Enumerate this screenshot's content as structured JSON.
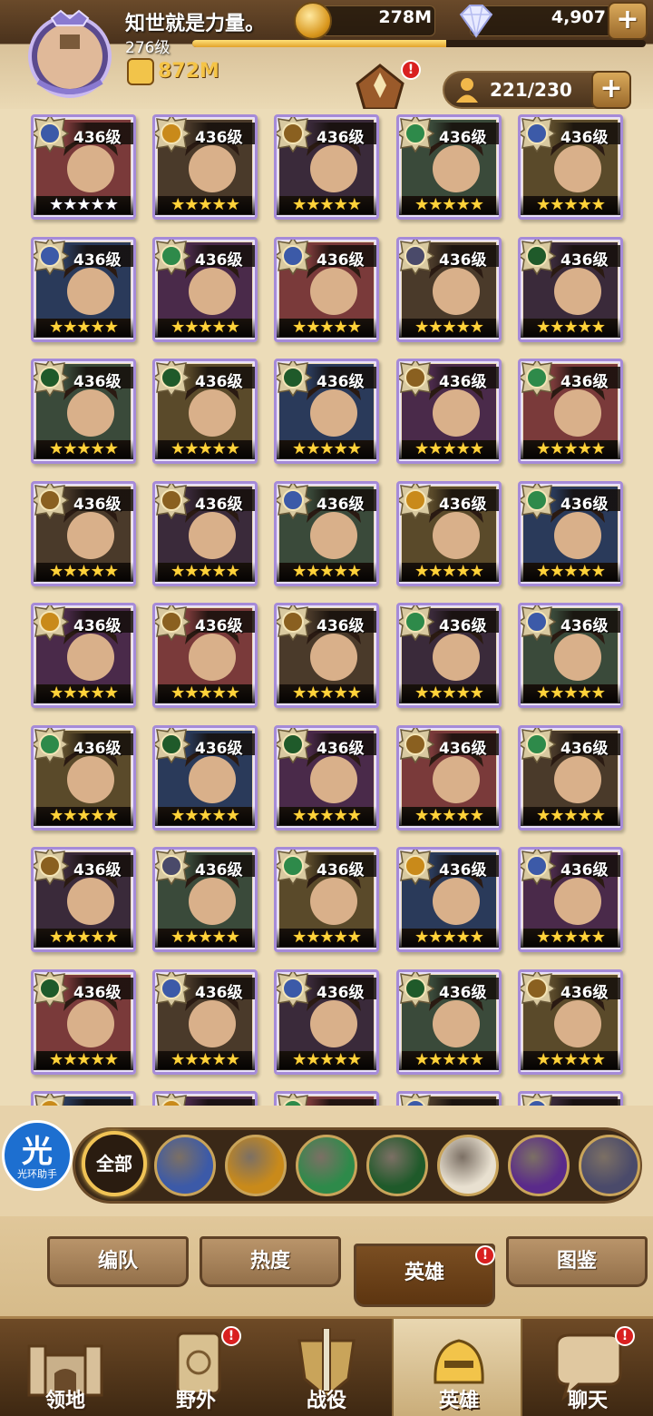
{
  "player": {
    "name": "知世就是力量。",
    "level": "276级",
    "power": "872M",
    "xp_fraction": 0.56
  },
  "resources": {
    "gold": "278M",
    "gems": "4,907"
  },
  "hero_count": "221/230",
  "colors": {
    "celestial": "#3c5aa8",
    "lightbearer": "#c98a1a",
    "wilder": "#2e8a4a",
    "graveborn": "#1f5a2a",
    "mauler": "#8a6020",
    "hypogean": "#5a2a8a",
    "dimensional": "#4a4a6a"
  },
  "heroes": [
    {
      "faction": "celestial",
      "level": "436级",
      "stars": "white",
      "icon": "masked-hero-portrait"
    },
    {
      "faction": "lightbearer",
      "level": "436级",
      "stars": "gold",
      "icon": "white-hair-hero-portrait"
    },
    {
      "faction": "mauler",
      "level": "436级",
      "stars": "gold",
      "icon": "horned-hero-portrait"
    },
    {
      "faction": "wilder",
      "level": "436级",
      "stars": "gold",
      "icon": "goggle-hero-portrait"
    },
    {
      "faction": "celestial",
      "level": "436级",
      "stars": "gold",
      "icon": "bearded-king-portrait"
    },
    {
      "faction": "celestial",
      "level": "436级",
      "stars": "gold",
      "icon": "horned-woman-portrait"
    },
    {
      "faction": "wilder",
      "level": "436级",
      "stars": "gold",
      "icon": "raccoon-hero-portrait"
    },
    {
      "faction": "celestial",
      "level": "436级",
      "stars": "gold",
      "icon": "old-sage-portrait"
    },
    {
      "faction": "dimensional",
      "level": "436级",
      "stars": "gold",
      "icon": "red-hair-hero-portrait"
    },
    {
      "faction": "graveborn",
      "level": "436级",
      "stars": "gold",
      "icon": "dark-hair-hero-portrait"
    },
    {
      "faction": "graveborn",
      "level": "436级",
      "stars": "gold",
      "icon": "green-hood-portrait"
    },
    {
      "faction": "graveborn",
      "level": "436级",
      "stars": "gold",
      "icon": "ice-hero-portrait"
    },
    {
      "faction": "graveborn",
      "level": "436级",
      "stars": "gold",
      "icon": "skull-hero-portrait"
    },
    {
      "faction": "mauler",
      "level": "436级",
      "stars": "gold",
      "icon": "red-beast-portrait"
    },
    {
      "faction": "wilder",
      "level": "436级",
      "stars": "gold",
      "icon": "elf-hero-portrait"
    },
    {
      "faction": "mauler",
      "level": "436级",
      "stars": "gold",
      "icon": "blonde-hero-portrait"
    },
    {
      "faction": "mauler",
      "level": "436级",
      "stars": "gold",
      "icon": "curly-blonde-portrait"
    },
    {
      "faction": "celestial",
      "level": "436级",
      "stars": "gold",
      "icon": "dark-skin-hero-portrait"
    },
    {
      "faction": "lightbearer",
      "level": "436级",
      "stars": "gold",
      "icon": "beast-warrior-portrait"
    },
    {
      "faction": "wilder",
      "level": "436级",
      "stars": "gold",
      "icon": "pink-hair-portrait"
    },
    {
      "faction": "lightbearer",
      "level": "436级",
      "stars": "gold",
      "icon": "wolf-hero-portrait"
    },
    {
      "faction": "mauler",
      "level": "436级",
      "stars": "gold",
      "icon": "braided-hero-portrait"
    },
    {
      "faction": "mauler",
      "level": "436级",
      "stars": "gold",
      "icon": "chibi-hero-portrait"
    },
    {
      "faction": "wilder",
      "level": "436级",
      "stars": "gold",
      "icon": "dragon-hero-portrait"
    },
    {
      "faction": "celestial",
      "level": "436级",
      "stars": "gold",
      "icon": "joker-hero-portrait"
    },
    {
      "faction": "wilder",
      "level": "436级",
      "stars": "gold",
      "icon": "sheep-hero-portrait"
    },
    {
      "faction": "graveborn",
      "level": "436级",
      "stars": "gold",
      "icon": "plague-doctor-portrait"
    },
    {
      "faction": "graveborn",
      "level": "436级",
      "stars": "gold",
      "icon": "dark-witch-portrait"
    },
    {
      "faction": "mauler",
      "level": "436级",
      "stars": "gold",
      "icon": "masked-pale-portrait"
    },
    {
      "faction": "wilder",
      "level": "436级",
      "stars": "gold",
      "icon": "silver-hair-portrait"
    },
    {
      "faction": "mauler",
      "level": "436级",
      "stars": "gold",
      "icon": "hooded-hero-portrait"
    },
    {
      "faction": "dimensional",
      "level": "436级",
      "stars": "gold",
      "icon": "green-hair-portrait"
    },
    {
      "faction": "wilder",
      "level": "436级",
      "stars": "gold",
      "icon": "white-hair-elf-portrait"
    },
    {
      "faction": "lightbearer",
      "level": "436级",
      "stars": "gold",
      "icon": "bull-hero-portrait"
    },
    {
      "faction": "celestial",
      "level": "436级",
      "stars": "gold",
      "icon": "red-hood-portrait"
    },
    {
      "faction": "graveborn",
      "level": "436级",
      "stars": "gold",
      "icon": "gray-hair-portrait"
    },
    {
      "faction": "celestial",
      "level": "436级",
      "stars": "gold",
      "icon": "masked-brown-hair-portrait"
    },
    {
      "faction": "celestial",
      "level": "436级",
      "stars": "gold",
      "icon": "white-beard-sage-portrait"
    },
    {
      "faction": "graveborn",
      "level": "436级",
      "stars": "gold",
      "icon": "witch-hat-portrait"
    },
    {
      "faction": "mauler",
      "level": "436级",
      "stars": "gold",
      "icon": "old-warrior-portrait"
    },
    {
      "faction": "lightbearer",
      "level": "436级",
      "stars": "gold",
      "icon": "partial-hero-portrait"
    },
    {
      "faction": "lightbearer",
      "level": "436级",
      "stars": "gold",
      "icon": "partial-hero-portrait"
    },
    {
      "faction": "wilder",
      "level": "436级",
      "stars": "gold",
      "icon": "partial-hero-portrait"
    },
    {
      "faction": "celestial",
      "level": "436级",
      "stars": "gold",
      "icon": "partial-hero-portrait"
    },
    {
      "faction": "celestial",
      "level": "436级",
      "stars": "gold",
      "icon": "partial-hero-portrait"
    }
  ],
  "filters": {
    "all_label": "全部",
    "items": [
      "mauler-faction-icon",
      "lightbearer-faction-icon",
      "wilder-faction-icon",
      "graveborn-faction-icon",
      "celestial-faction-icon",
      "hypogean-faction-icon",
      "dimensional-faction-icon"
    ]
  },
  "helper": {
    "char": "光",
    "text": "光环助手"
  },
  "subtabs": [
    "编队",
    "热度",
    "英雄",
    "图鉴"
  ],
  "nav": [
    "领地",
    "野外",
    "战役",
    "英雄",
    "聊天"
  ]
}
